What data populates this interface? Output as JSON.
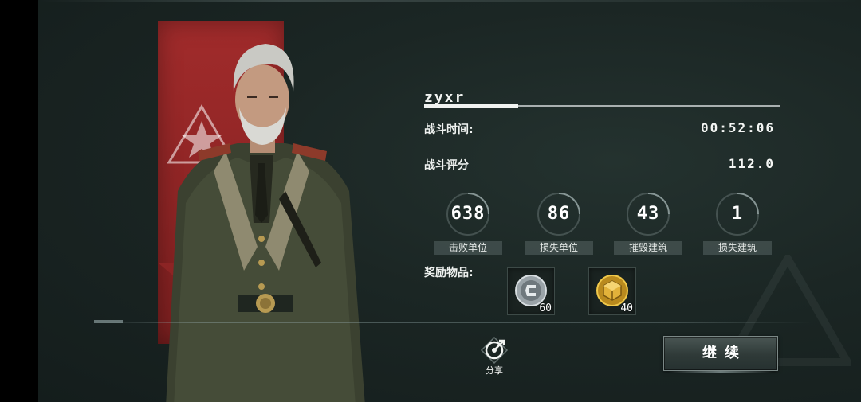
{
  "player": {
    "name": "zyxr"
  },
  "battle": {
    "time_label": "战斗时间:",
    "time_value": "00:52:06",
    "score_label": "战斗评分",
    "score_value": "112.0"
  },
  "stats": [
    {
      "value": "638",
      "label": "击败单位"
    },
    {
      "value": "86",
      "label": "损失单位"
    },
    {
      "value": "43",
      "label": "摧毁建筑"
    },
    {
      "value": "1",
      "label": "损失建筑"
    }
  ],
  "rewards": {
    "label": "奖励物品:",
    "items": [
      {
        "icon": "silver-coin-icon",
        "count": "60"
      },
      {
        "icon": "gold-crate-icon",
        "count": "40"
      }
    ]
  },
  "actions": {
    "share_label": "分享",
    "continue_label": "继续"
  },
  "colors": {
    "background": "#1b2624",
    "banner_red": "#9a2828",
    "accent_white": "#f0f2f0"
  }
}
